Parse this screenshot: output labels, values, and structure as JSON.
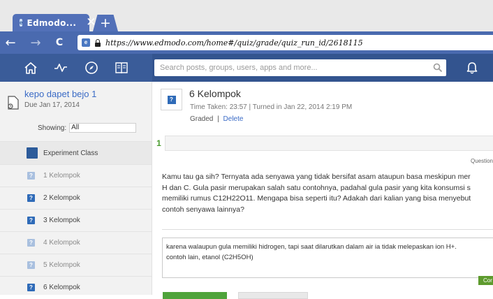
{
  "browser": {
    "tab_title": "Edmodo...",
    "tab_close": "✕",
    "new_tab": "+",
    "back": "←",
    "forward": "→",
    "reload": "C",
    "url": "https://www.edmodo.com/home#/quiz/grade/quiz_run_id/2618115"
  },
  "search": {
    "placeholder": "Search posts, groups, users, apps and more..."
  },
  "sidebar": {
    "quiz_title": "kepo dapet bejo 1",
    "quiz_due": "Due Jan 17, 2014",
    "showing_label": "Showing:",
    "showing_value": "All",
    "groups": [
      {
        "label": "Experiment Class"
      },
      {
        "label": "1 Kelompok"
      },
      {
        "label": "2 Kelompok"
      },
      {
        "label": "3 Kelompok"
      },
      {
        "label": "4 Kelompok"
      },
      {
        "label": "5 Kelompok"
      },
      {
        "label": "6 Kelompok"
      }
    ]
  },
  "submission": {
    "group": "6 Kelompok",
    "meta": "Time Taken: 23:57  |  Turned in Jan 22, 2014 2:19 PM",
    "graded": "Graded",
    "separator": "|",
    "delete": "Delete",
    "icon_glyph": "?"
  },
  "question": {
    "tab": "1",
    "label": "Question",
    "lines": [
      "Kamu tau ga sih? Ternyata ada senyawa yang tidak bersifat asam ataupun basa meskipun mer",
      "H dan C. Gula pasir merupakan salah satu contohnya, padahal gula pasir yang kita konsumsi s",
      "memiliki rumus C12H22O11. Mengapa bisa seperti itu? Adakah dari kalian yang bisa menyebut",
      "contoh senyawa lainnya?"
    ]
  },
  "answer": {
    "lines": [
      "karena walaupun gula memiliki hidrogen, tapi saat dilarutkan dalam air ia tidak melepaskan ion H+.",
      "contoh lain, etanol (C2H5OH)"
    ],
    "badge": "Cor"
  },
  "colors": {
    "chrome_tab": "#5270b8",
    "toolbar": "#4a6aaf",
    "appbar": "#33548f",
    "link": "#3b6bc6",
    "green": "#4fa33b"
  }
}
